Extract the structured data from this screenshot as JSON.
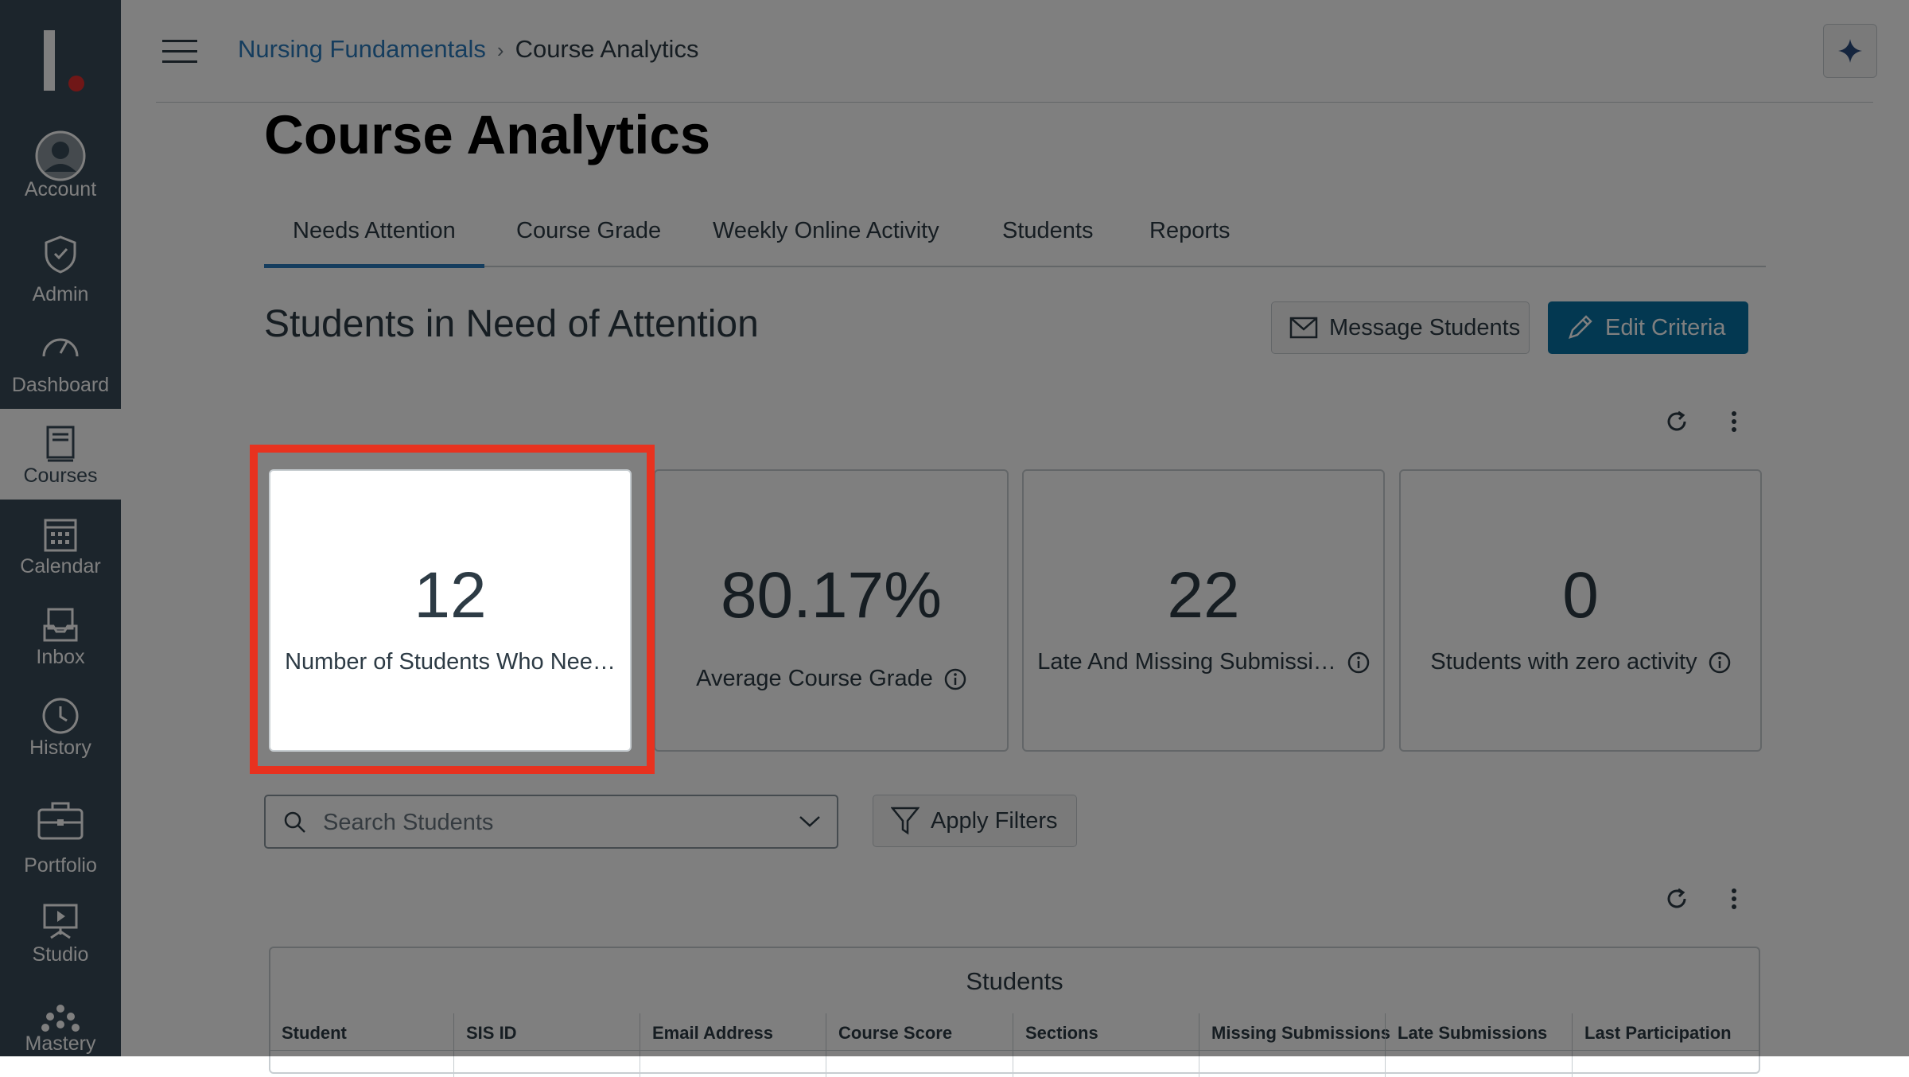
{
  "nav": {
    "items": [
      {
        "label": "Account",
        "icon": "account-icon"
      },
      {
        "label": "Admin",
        "icon": "shield-icon"
      },
      {
        "label": "Dashboard",
        "icon": "dashboard-icon"
      },
      {
        "label": "Courses",
        "icon": "book-icon",
        "active": true
      },
      {
        "label": "Calendar",
        "icon": "calendar-icon"
      },
      {
        "label": "Inbox",
        "icon": "inbox-icon"
      },
      {
        "label": "History",
        "icon": "clock-icon"
      },
      {
        "label": "Portfolio",
        "icon": "briefcase-icon"
      },
      {
        "label": "Studio",
        "icon": "studio-icon"
      },
      {
        "label": "Mastery",
        "icon": "mastery-icon"
      }
    ]
  },
  "breadcrumb": {
    "course": "Nursing Fundamentals",
    "current": "Course Analytics"
  },
  "page_title": "Course Analytics",
  "tabs": [
    "Needs Attention",
    "Course Grade",
    "Weekly Online Activity",
    "Students",
    "Reports"
  ],
  "section_title": "Students in Need of Attention",
  "buttons": {
    "message": "Message Students",
    "edit": "Edit Criteria",
    "filter": "Apply Filters"
  },
  "cards": [
    {
      "value": "12",
      "label": "Number of Students Who Nee…"
    },
    {
      "value": "80.17%",
      "label": "Average Course Grade"
    },
    {
      "value": "22",
      "label": "Late And Missing Submissi…"
    },
    {
      "value": "0",
      "label": "Students with zero activity"
    }
  ],
  "search": {
    "placeholder": "Search Students"
  },
  "table": {
    "caption": "Students",
    "headers": [
      "Student",
      "SIS ID",
      "Email Address",
      "Course Score",
      "Sections",
      "Missing Submissions",
      "Late Submissions",
      "Last Participation"
    ]
  },
  "colors": {
    "nav_bg": "#394b58",
    "primary": "#0770a3",
    "link": "#2b7abc",
    "highlight": "#e8321f"
  }
}
